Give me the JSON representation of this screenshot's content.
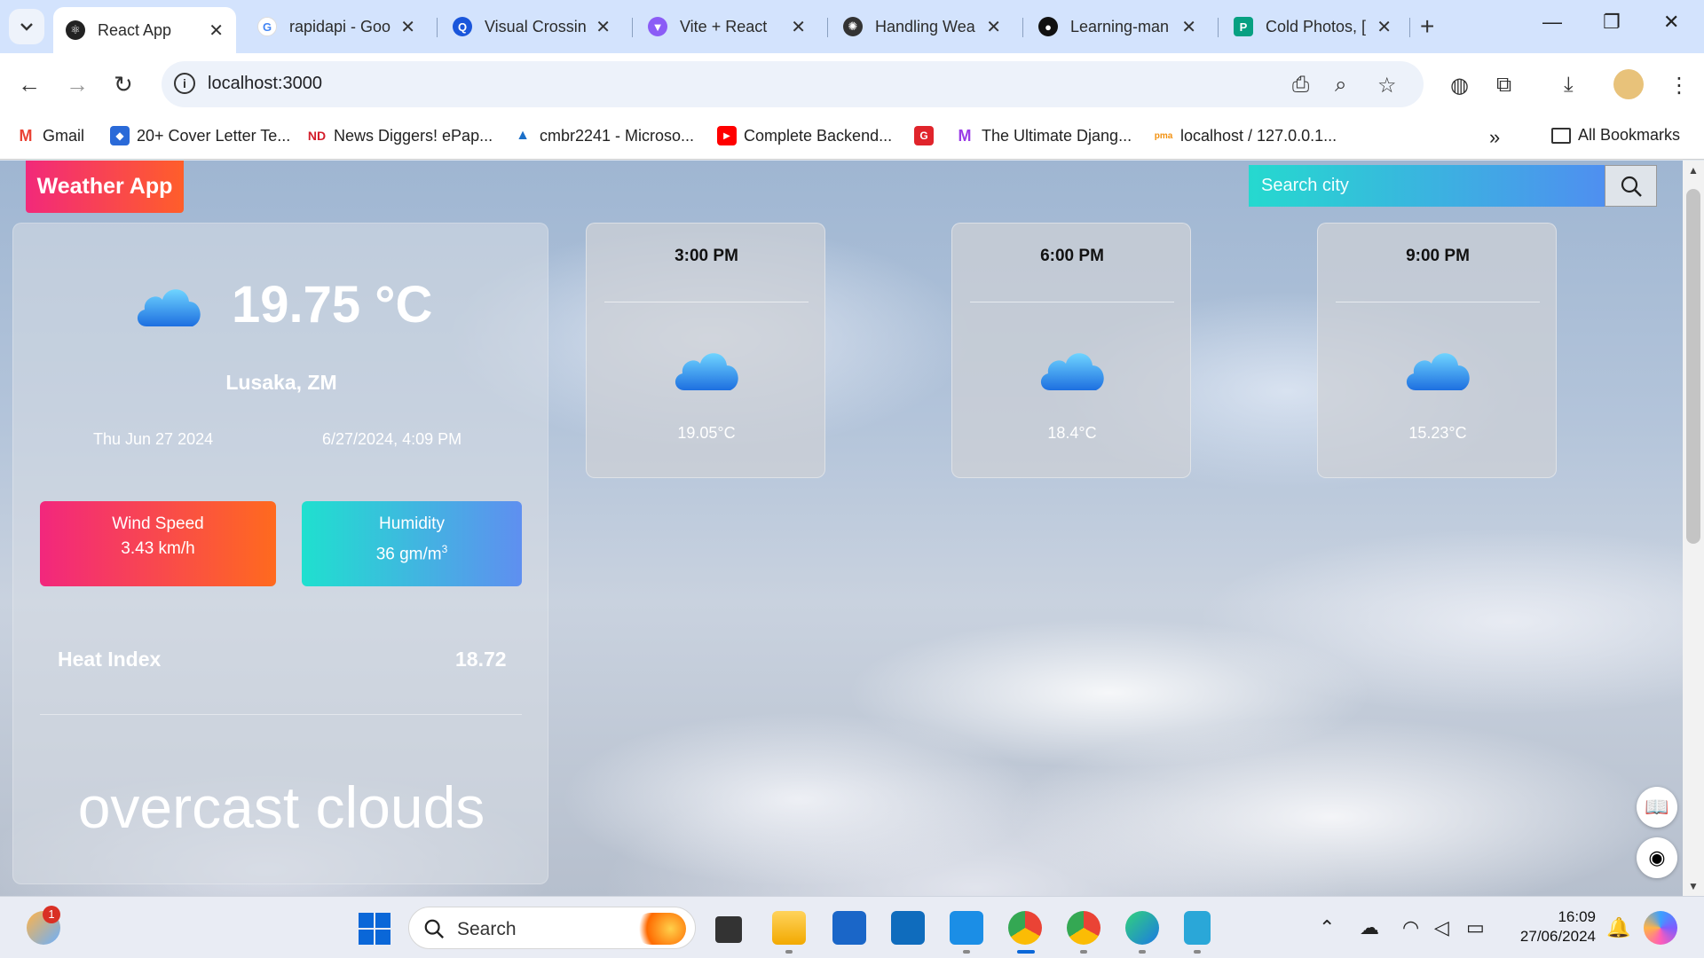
{
  "browser": {
    "tabs": [
      {
        "title": "React App",
        "active": true,
        "favicon": "react-icon",
        "color": "#222222"
      },
      {
        "title": "rapidapi - Goo",
        "favicon": "google-icon",
        "color": "#4285f4"
      },
      {
        "title": "Visual Crossin",
        "favicon": "visualcrossing-icon",
        "color": "#1a56db"
      },
      {
        "title": "Vite + React",
        "favicon": "vite-icon",
        "color": "#8b5cf6"
      },
      {
        "title": "Handling Wea",
        "favicon": "openai-icon",
        "color": "#333333"
      },
      {
        "title": "Learning-man",
        "favicon": "github-icon",
        "color": "#111111"
      },
      {
        "title": "Cold Photos, [",
        "favicon": "pexels-icon",
        "color": "#07a081"
      }
    ],
    "url": "localhost:3000",
    "bookmarks": [
      {
        "label": "Gmail",
        "color": "#ea4335",
        "glyph": "M"
      },
      {
        "label": "20+ Cover Letter Te...",
        "color": "#2a6ad8",
        "glyph": "◆"
      },
      {
        "label": "News Diggers! ePap...",
        "color": "#d31d2a",
        "glyph": "ND"
      },
      {
        "label": "cmbr2241 - Microso...",
        "color": "#1b6fc8",
        "glyph": "▲"
      },
      {
        "label": "Complete Backend...",
        "color": "#ff0000",
        "glyph": "▶"
      },
      {
        "label": "",
        "color": "#e0242b",
        "glyph": "G"
      },
      {
        "label": "The Ultimate Djang...",
        "color": "#9b3de6",
        "glyph": "M"
      },
      {
        "label": "localhost / 127.0.0.1...",
        "color": "#f29111",
        "glyph": "pma"
      }
    ],
    "all_bookmarks": "All Bookmarks"
  },
  "app": {
    "brand": "Weather App",
    "search_placeholder": "Search city",
    "current": {
      "temp": "19.75 °C",
      "location": "Lusaka, ZM",
      "date": "Thu Jun 27 2024",
      "datetime": "6/27/2024, 4:09 PM",
      "wind_label": "Wind Speed",
      "wind_value": "3.43 km/h",
      "humidity_label": "Humidity",
      "humidity_value": "36 gm/m",
      "humidity_sup": "3",
      "heat_index_label": "Heat Index",
      "heat_index_value": "18.72",
      "description": "overcast clouds"
    },
    "forecast": [
      {
        "time": "3:00 PM",
        "temp": "19.05°C",
        "icon": "cloud-icon"
      },
      {
        "time": "6:00 PM",
        "temp": "18.4°C",
        "icon": "cloud-icon"
      },
      {
        "time": "9:00 PM",
        "temp": "15.23°C",
        "icon": "cloud-icon"
      }
    ]
  },
  "taskbar": {
    "search_label": "Search",
    "time": "16:09",
    "date": "27/06/2024",
    "weather_badge": "1"
  }
}
